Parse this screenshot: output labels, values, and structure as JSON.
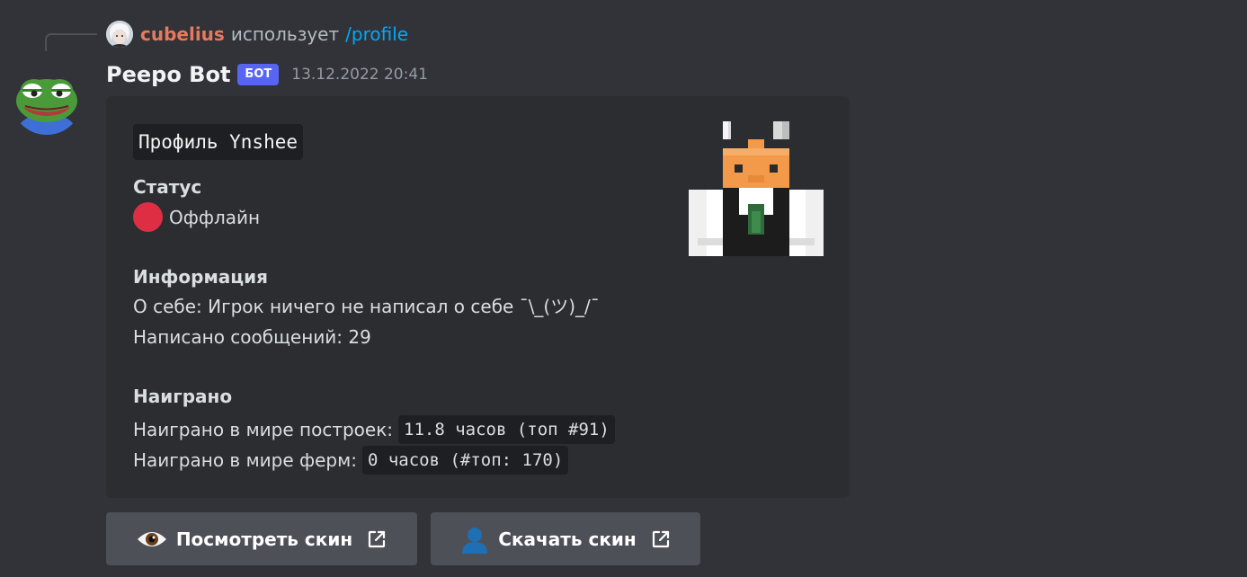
{
  "reply": {
    "username": "cubelius",
    "uses_text": "использует",
    "command": "/profile"
  },
  "message": {
    "bot_name": "Peepo Bot",
    "bot_badge": "БОТ",
    "timestamp": "13.12.2022 20:41"
  },
  "embed": {
    "title": "Профиль Ynshee",
    "status": {
      "heading": "Статус",
      "value": "Оффлайн",
      "icon": "red-circle-icon"
    },
    "info": {
      "heading": "Информация",
      "about": "О себе: Игрок ничего не написал о себе ¯\\_(ツ)_/¯",
      "messages": "Написано сообщений: 29"
    },
    "played": {
      "heading": "Наиграно",
      "build_label": "Наиграно в мире построек:",
      "build_value": "11.8 часов (топ #91)",
      "farm_label": "Наиграно в мире ферм:",
      "farm_value": "0 часов (#топ: 170)"
    },
    "thumbnail_icon": "minecraft-skin-head-icon"
  },
  "buttons": [
    {
      "label": "Посмотреть скин",
      "emoji": "eye-icon",
      "link_icon": "external-link-icon"
    },
    {
      "label": "Скачать скин",
      "emoji": "bust-silhouette-icon",
      "link_icon": "external-link-icon"
    }
  ],
  "colors": {
    "background": "#313338",
    "embed_bg": "#2b2d31",
    "code_bg": "#1e1f22",
    "badge": "#5865f2",
    "reply_user": "#e8795e",
    "command": "#00a8fc",
    "button": "#4e5058",
    "status_red": "#dd2e44"
  }
}
